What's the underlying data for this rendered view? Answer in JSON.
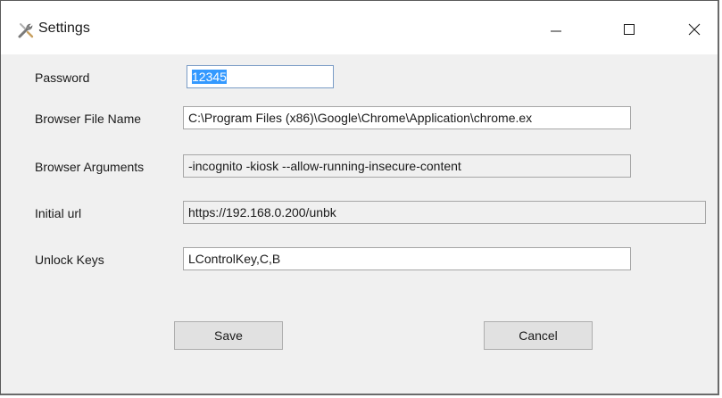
{
  "window": {
    "title": "Settings",
    "icon": "tools-icon"
  },
  "controls": {
    "minimize_icon": "minimize-icon",
    "maximize_icon": "maximize-icon",
    "close_icon": "close-icon"
  },
  "form": {
    "password": {
      "label": "Password",
      "value": "12345"
    },
    "browser_file_name": {
      "label": "Browser File Name",
      "value": "C:\\Program Files (x86)\\Google\\Chrome\\Application\\chrome.ex"
    },
    "browser_arguments": {
      "label": "Browser Arguments",
      "value": "-incognito -kiosk --allow-running-insecure-content"
    },
    "initial_url": {
      "label": "Initial url",
      "value": "https://192.168.0.200/unbk"
    },
    "unlock_keys": {
      "label": "Unlock Keys",
      "value": "LControlKey,C,B"
    }
  },
  "buttons": {
    "save": "Save",
    "cancel": "Cancel"
  },
  "colors": {
    "selection": "#3399ff",
    "window_bg": "#f0f0f0"
  }
}
